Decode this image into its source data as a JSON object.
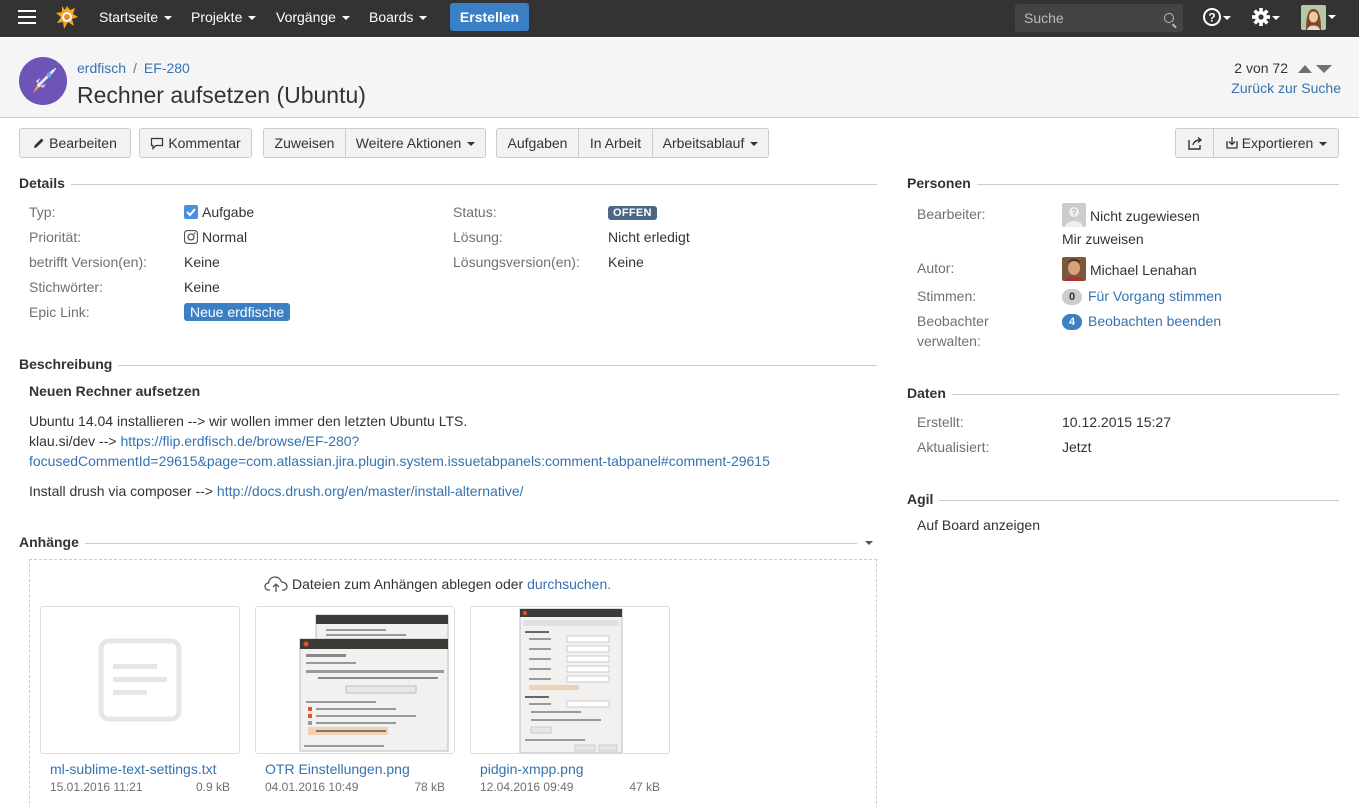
{
  "topbar": {
    "nav": [
      "Startseite",
      "Projekte",
      "Vorgänge",
      "Boards"
    ],
    "create_label": "Erstellen",
    "search_placeholder": "Suche"
  },
  "header": {
    "project_key": "erdfisch",
    "issue_key": "EF-280",
    "title": "Rechner aufsetzen (Ubuntu)",
    "pager": "2 von 72",
    "back_to_search": "Zurück zur Suche"
  },
  "toolbar": {
    "edit": "Bearbeiten",
    "comment": "Kommentar",
    "assign": "Zuweisen",
    "more_actions": "Weitere Aktionen",
    "tasks": "Aufgaben",
    "in_progress": "In Arbeit",
    "workflow": "Arbeitsablauf",
    "export": "Exportieren"
  },
  "details": {
    "title": "Details",
    "type_label": "Typ:",
    "type_value": "Aufgabe",
    "priority_label": "Priorität:",
    "priority_value": "Normal",
    "affects_label": "betrifft Version(en):",
    "affects_value": "Keine",
    "labels_label": "Stichwörter:",
    "labels_value": "Keine",
    "epic_label": "Epic Link:",
    "epic_value": "Neue erdfische",
    "status_label": "Status:",
    "status_value": "OFFEN",
    "resolution_label": "Lösung:",
    "resolution_value": "Nicht erledigt",
    "fix_label": "Lösungsversion(en):",
    "fix_value": "Keine"
  },
  "description": {
    "title": "Beschreibung",
    "heading": "Neuen Rechner aufsetzen",
    "line1": "Ubuntu 14.04 installieren --> wir wollen immer den letzten Ubuntu LTS.",
    "line2_prefix": "klau.si/dev --> ",
    "line2_link_a": "https://flip.erdfisch.de/browse/EF-280?",
    "line2_link_b": "focusedCommentId=29615&page=com.atlassian.jira.plugin.system.issuetabpanels:comment-tabpanel#comment-29615",
    "line3_prefix": "Install drush via composer --> ",
    "line3_link": "http://docs.drush.org/en/master/install-alternative/"
  },
  "attachments": {
    "title": "Anhänge",
    "drop_text": "Dateien zum Anhängen ablegen oder ",
    "drop_link": "durchsuchen.",
    "files": [
      {
        "name": "ml-sublime-text-settings.txt",
        "date": "15.01.2016 11:21",
        "size": "0.9 kB"
      },
      {
        "name": "OTR Einstellungen.png",
        "date": "04.01.2016 10:49",
        "size": "78 kB"
      },
      {
        "name": "pidgin-xmpp.png",
        "date": "12.04.2016 09:49",
        "size": "47 kB"
      }
    ]
  },
  "people": {
    "title": "Personen",
    "assignee_label": "Bearbeiter:",
    "assignee_value": "Nicht zugewiesen",
    "assign_me": "Mir zuweisen",
    "reporter_label": "Autor:",
    "reporter_value": "Michael Lenahan",
    "votes_label": "Stimmen:",
    "votes_count": "0",
    "votes_link": "Für Vorgang stimmen",
    "watchers_label_1": "Beobachter",
    "watchers_label_2": "verwalten:",
    "watchers_count": "4",
    "watchers_link": "Beobachten beenden"
  },
  "dates": {
    "title": "Daten",
    "created_label": "Erstellt:",
    "created_value": "10.12.2015 15:27",
    "updated_label": "Aktualisiert:",
    "updated_value": "Jetzt"
  },
  "agile": {
    "title": "Agil",
    "board_link": "Auf Board anzeigen"
  },
  "colors": {
    "topbar": "#333333",
    "accent": "#3b7fc4",
    "link": "#3572b0",
    "status": "#4a6785"
  }
}
